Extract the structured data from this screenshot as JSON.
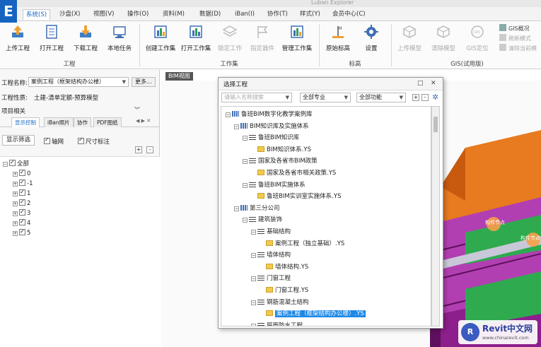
{
  "app": {
    "title": "Luban Explorer",
    "logo_letter": "E"
  },
  "menu": {
    "items": [
      "系统(S)",
      "沙盘(X)",
      "视图(V)",
      "操作(O)",
      "资料(M)",
      "数据(D)",
      "iBan(I)",
      "协作(T)",
      "样式(Y)",
      "会员中心(C)"
    ],
    "active_index": 0
  },
  "ribbon": {
    "groups": [
      {
        "label": "工程",
        "buttons": [
          "上传工程",
          "打开工程",
          "下载工程",
          "本地任务"
        ]
      },
      {
        "label": "工作集",
        "buttons": [
          "创建工作集",
          "打开工作集",
          "锁定工作",
          "指定器件",
          "管理工作集"
        ]
      },
      {
        "label": "标高",
        "buttons": [
          "原始标高",
          "设置"
        ]
      },
      {
        "label": "GIS(试用版)",
        "buttons": [
          "上传模型",
          "清除模型",
          "GIS定位"
        ],
        "small_buttons": [
          "GIS概况",
          "刷新模式",
          "清除当前模"
        ]
      }
    ]
  },
  "left_panel": {
    "project_name_label": "工程名称:",
    "project_name_value": "案例工程（框架结构办公楼）",
    "more_label": "更多...",
    "project_type_label": "工程性质:",
    "project_type_value": "土建-清单定额-预算模型",
    "project_related_label": "项目相关",
    "tabs": [
      "显示控制",
      "iBan照片",
      "协作",
      "PDF图纸"
    ],
    "filter_button": "显示筛选",
    "axis_net_label": "轴网",
    "dimension_label": "尺寸标注",
    "tree": {
      "root": "全部",
      "items": [
        "0",
        "-1",
        "1",
        "2",
        "3",
        "4",
        "5"
      ]
    }
  },
  "bim_view": {
    "tab_label": "BIM视图",
    "label_1": "构件节点",
    "label_2": "构件节点"
  },
  "dialog": {
    "title": "选择工程",
    "search_placeholder": "请输入名称搜索",
    "specialty": "全部专业",
    "function": "全部功能",
    "plus_label": "+",
    "minus_label": "-",
    "tree": [
      {
        "indent": 0,
        "icon": "bars",
        "text": "鲁班BIM数字化教学案例库"
      },
      {
        "indent": 1,
        "icon": "bars",
        "text": "BIM知识库及实施体系"
      },
      {
        "indent": 2,
        "icon": "lines",
        "text": "鲁班BIM知识库"
      },
      {
        "indent": 3,
        "icon": "folder",
        "text": "BIM知识体系.YS"
      },
      {
        "indent": 2,
        "icon": "lines",
        "text": "国家及各省市BIM政策"
      },
      {
        "indent": 3,
        "icon": "folder",
        "text": "国家及各省市相关政策.YS"
      },
      {
        "indent": 2,
        "icon": "lines",
        "text": "鲁班BIM实施体系"
      },
      {
        "indent": 3,
        "icon": "folder",
        "text": "鲁班BIM实训室实施体系.YS"
      },
      {
        "indent": 1,
        "icon": "bars",
        "text": "第三分公司"
      },
      {
        "indent": 2,
        "icon": "lines",
        "text": "建筑装饰"
      },
      {
        "indent": 3,
        "icon": "lines",
        "text": "基础结构"
      },
      {
        "indent": 4,
        "icon": "folder",
        "text": "案例工程（独立基础）.YS"
      },
      {
        "indent": 3,
        "icon": "lines",
        "text": "墙体结构"
      },
      {
        "indent": 4,
        "icon": "folder",
        "text": "墙体结构.YS"
      },
      {
        "indent": 3,
        "icon": "lines",
        "text": "门窗工程"
      },
      {
        "indent": 4,
        "icon": "folder",
        "text": "门窗工程.YS"
      },
      {
        "indent": 3,
        "icon": "lines",
        "text": "钢筋混凝土结构"
      },
      {
        "indent": 4,
        "icon": "folder",
        "text": "案例工程（框架结构办公楼）.YS",
        "selected": true
      },
      {
        "indent": 3,
        "icon": "lines",
        "text": "屋面防水工程"
      }
    ]
  },
  "watermark": {
    "text": "Revit中文网",
    "url": "www.chinarevit.com",
    "logo_letter": "R"
  }
}
